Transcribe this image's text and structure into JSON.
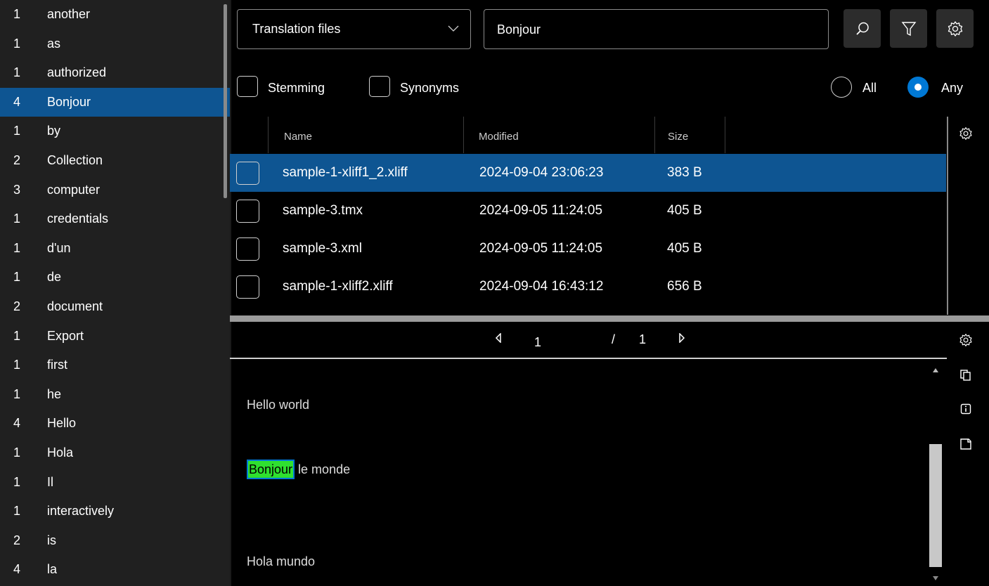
{
  "wordlist": {
    "items": [
      {
        "count": "1",
        "word": "another"
      },
      {
        "count": "1",
        "word": "as"
      },
      {
        "count": "1",
        "word": "authorized"
      },
      {
        "count": "4",
        "word": "Bonjour",
        "selected": true
      },
      {
        "count": "1",
        "word": "by"
      },
      {
        "count": "2",
        "word": "Collection"
      },
      {
        "count": "3",
        "word": "computer"
      },
      {
        "count": "1",
        "word": "credentials"
      },
      {
        "count": "1",
        "word": "d'un"
      },
      {
        "count": "1",
        "word": "de"
      },
      {
        "count": "2",
        "word": "document"
      },
      {
        "count": "1",
        "word": "Export"
      },
      {
        "count": "1",
        "word": "first"
      },
      {
        "count": "1",
        "word": "he"
      },
      {
        "count": "4",
        "word": "Hello"
      },
      {
        "count": "1",
        "word": "Hola"
      },
      {
        "count": "1",
        "word": "Il"
      },
      {
        "count": "1",
        "word": "interactively"
      },
      {
        "count": "2",
        "word": "is"
      },
      {
        "count": "4",
        "word": "la"
      }
    ]
  },
  "toolbar": {
    "collection_label": "Translation files",
    "search_value": "Bonjour"
  },
  "options": {
    "stemming": "Stemming",
    "synonyms": "Synonyms",
    "all": "All",
    "any": "Any",
    "selected_match": "Any"
  },
  "table": {
    "headers": {
      "name": "Name",
      "modified": "Modified",
      "size": "Size"
    },
    "rows": [
      {
        "name": "sample-1-xliff1_2.xliff",
        "modified": "2024-09-04 23:06:23",
        "size": "383 B",
        "selected": true
      },
      {
        "name": "sample-3.tmx",
        "modified": "2024-09-05 11:24:05",
        "size": "405 B"
      },
      {
        "name": "sample-3.xml",
        "modified": "2024-09-05 11:24:05",
        "size": "405 B"
      },
      {
        "name": "sample-1-xliff2.xliff",
        "modified": "2024-09-04 16:43:12",
        "size": "656 B"
      }
    ]
  },
  "pager": {
    "current": "1",
    "separator": "/",
    "total": "1"
  },
  "content": {
    "line1": "Hello world",
    "line2_highlight": "Bonjour",
    "line2_rest": " le monde",
    "line3": "Hola mundo"
  },
  "colors": {
    "selection": "#0e5592",
    "accent": "#0078d4",
    "highlight": "#2fe02f",
    "panel": "#202020"
  }
}
